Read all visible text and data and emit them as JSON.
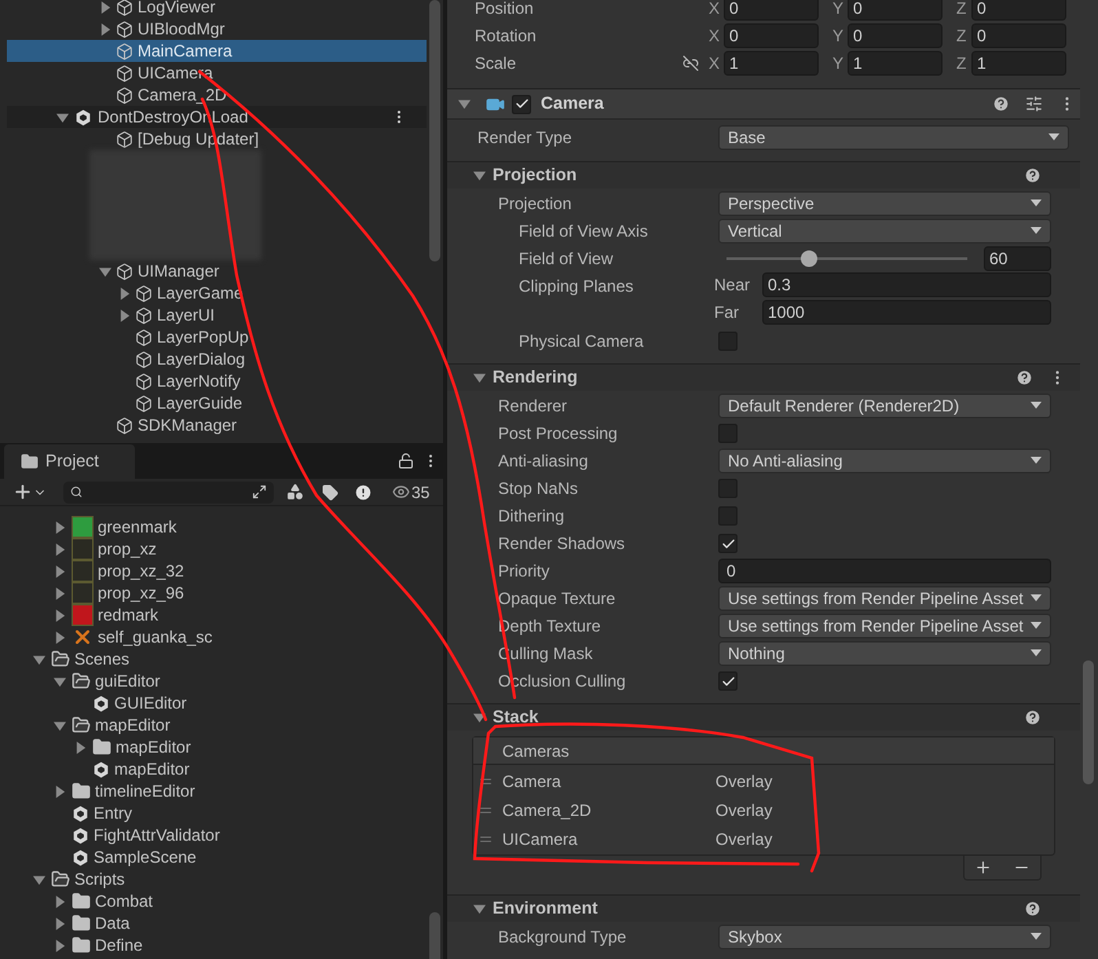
{
  "hierarchy": {
    "loose_items": [
      {
        "label": "LogViewer",
        "expanded": false,
        "selected": false
      },
      {
        "label": "UIBloodMgr",
        "expanded": false,
        "selected": false
      },
      {
        "label": "MainCamera",
        "selected": true
      },
      {
        "label": "UICamera",
        "selected": false
      },
      {
        "label": "Camera_2D",
        "selected": false
      }
    ],
    "scenes": [
      {
        "label": "DontDestroyOnLoad",
        "expanded": true,
        "children": [
          {
            "label": "[Debug Updater]",
            "selected": false
          },
          {
            "kind": "redacted"
          },
          {
            "label": "UIManager",
            "expanded": true,
            "selected": false,
            "children": [
              {
                "label": "LayerGame",
                "expanded": false,
                "selected": false
              },
              {
                "label": "LayerUI",
                "expanded": false,
                "selected": false
              },
              {
                "label": "LayerPopUp",
                "selected": false
              },
              {
                "label": "LayerDialog",
                "selected": false
              },
              {
                "label": "LayerNotify",
                "selected": false
              },
              {
                "label": "LayerGuide",
                "selected": false
              }
            ]
          },
          {
            "label": "SDKManager",
            "selected": false
          }
        ]
      }
    ]
  },
  "project": {
    "tab": "Project",
    "hidden_count": "35",
    "loose_items": [
      {
        "label": "greenmark",
        "kind": "swatch",
        "color": "#2e9c3f",
        "expanded": false
      },
      {
        "label": "prop_xz",
        "kind": "swatch",
        "color": "#2a2a22",
        "expanded": false
      },
      {
        "label": "prop_xz_32",
        "kind": "swatch",
        "color": "#2a2a23",
        "expanded": false
      },
      {
        "label": "prop_xz_96",
        "kind": "swatch",
        "color": "#2a2a24",
        "expanded": false
      },
      {
        "label": "redmark",
        "kind": "swatch",
        "color": "#c0161c",
        "expanded": false
      },
      {
        "label": "self_guanka_sc",
        "kind": "cross",
        "expanded": false
      }
    ],
    "tree": [
      {
        "label": "Scenes",
        "kind": "folder",
        "expanded": true,
        "children": [
          {
            "label": "guiEditor",
            "kind": "folder",
            "expanded": true,
            "children": [
              {
                "label": "GUIEditor",
                "kind": "scene"
              }
            ]
          },
          {
            "label": "mapEditor",
            "kind": "folder",
            "expanded": true,
            "children": [
              {
                "label": "mapEditor",
                "kind": "folder",
                "expanded": false
              },
              {
                "label": "mapEditor",
                "kind": "scene"
              }
            ]
          },
          {
            "label": "timelineEditor",
            "kind": "folder",
            "expanded": false
          },
          {
            "label": "Entry",
            "kind": "scene"
          },
          {
            "label": "FightAttrValidator",
            "kind": "scene"
          },
          {
            "label": "SampleScene",
            "kind": "scene"
          }
        ]
      },
      {
        "label": "Scripts",
        "kind": "folder",
        "expanded": true,
        "children": [
          {
            "label": "Combat",
            "kind": "folder",
            "expanded": false
          },
          {
            "label": "Data",
            "kind": "folder",
            "expanded": false
          },
          {
            "label": "Define",
            "kind": "folder",
            "expanded": false
          }
        ]
      }
    ]
  },
  "inspector": {
    "transform": [
      {
        "label": "Position",
        "constraint_toggle": false,
        "values": [
          {
            "axis": "X",
            "value": "0"
          },
          {
            "axis": "Y",
            "value": "0"
          },
          {
            "axis": "Z",
            "value": "0"
          }
        ]
      },
      {
        "label": "Rotation",
        "constraint_toggle": false,
        "values": [
          {
            "axis": "X",
            "value": "0"
          },
          {
            "axis": "Y",
            "value": "0"
          },
          {
            "axis": "Z",
            "value": "0"
          }
        ]
      },
      {
        "label": "Scale",
        "constraint_toggle": true,
        "values": [
          {
            "axis": "X",
            "value": "1"
          },
          {
            "axis": "Y",
            "value": "1"
          },
          {
            "axis": "Z",
            "value": "1"
          }
        ]
      }
    ],
    "camera": {
      "title": "Camera",
      "enabled": true,
      "expanded": true,
      "render_type": {
        "label": "Render Type",
        "value": "Base"
      },
      "sections": [
        {
          "title": "Projection",
          "kind": "fields",
          "expanded": true,
          "menu": false,
          "rows": [
            {
              "kind": "dropdown",
              "label": "Projection",
              "value": "Perspective",
              "children": [
                {
                  "kind": "dropdown",
                  "label": "Field of View Axis",
                  "value": "Vertical"
                },
                {
                  "kind": "slider",
                  "label": "Field of View",
                  "level": 0.34,
                  "value": "60"
                },
                {
                  "kind": "clip",
                  "label": "Clipping Planes",
                  "near_label": "Near",
                  "near": "0.3",
                  "far_label": "Far",
                  "far": "1000"
                },
                {
                  "kind": "checkbox",
                  "label": "Physical Camera",
                  "checked": false
                }
              ]
            }
          ]
        },
        {
          "title": "Rendering",
          "kind": "fields",
          "expanded": true,
          "menu": true,
          "rows": [
            {
              "kind": "dropdown",
              "label": "Renderer",
              "value": "Default Renderer (Renderer2D)"
            },
            {
              "kind": "checkbox",
              "label": "Post Processing",
              "checked": false
            },
            {
              "kind": "dropdown",
              "label": "Anti-aliasing",
              "value": "No Anti-aliasing"
            },
            {
              "kind": "checkbox",
              "label": "Stop NaNs",
              "checked": false
            },
            {
              "kind": "checkbox",
              "label": "Dithering",
              "checked": false
            },
            {
              "kind": "checkbox",
              "label": "Render Shadows",
              "checked": true
            },
            {
              "kind": "field",
              "label": "Priority",
              "value": "0"
            },
            {
              "kind": "dropdown",
              "label": "Opaque Texture",
              "value": "Use settings from Render Pipeline Asset"
            },
            {
              "kind": "dropdown",
              "label": "Depth Texture",
              "value": "Use settings from Render Pipeline Asset"
            },
            {
              "kind": "dropdown",
              "label": "Culling Mask",
              "value": "Nothing"
            },
            {
              "kind": "checkbox",
              "label": "Occlusion Culling",
              "checked": true
            }
          ]
        },
        {
          "title": "Stack",
          "kind": "stack",
          "expanded": true,
          "menu": false,
          "list": {
            "header": "Cameras",
            "rows": [
              {
                "name": "Camera",
                "type": "Overlay"
              },
              {
                "name": "Camera_2D",
                "type": "Overlay"
              },
              {
                "name": "UICamera",
                "type": "Overlay"
              }
            ]
          }
        },
        {
          "title": "Environment",
          "kind": "fields",
          "expanded": true,
          "menu": false,
          "rows": [
            {
              "kind": "dropdown",
              "label": "Background Type",
              "value": "Skybox"
            }
          ]
        }
      ]
    }
  }
}
